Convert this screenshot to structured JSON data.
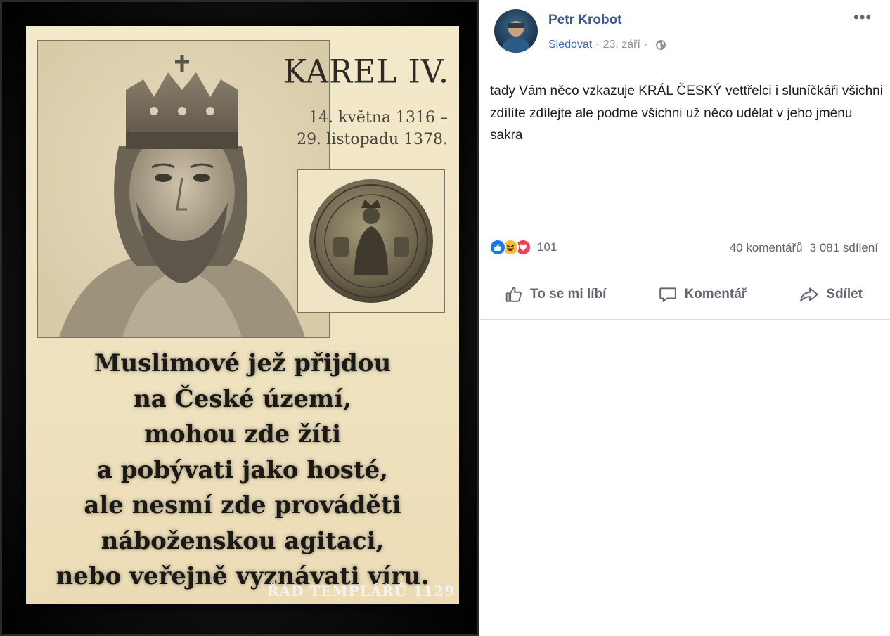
{
  "image": {
    "title": "KAREL IV.",
    "dates_line1": "14. května 1316 –",
    "dates_line2": "29. listopadu 1378.",
    "quote": "Muslimové jež přijdou\nna České území,\nmohou zde žíti\na pobývati jako hosté,\nale nesmí zde prováděti\nnáboženskou agitaci,\nnebo veřejně vyznávati víru.",
    "footer": "ŘÁD TEMPLÁŘŮ 1129"
  },
  "post": {
    "author": "Petr Krobot",
    "follow": "Sledovat",
    "separator": "·",
    "date": "23. září",
    "more": "•••",
    "text": "tady Vám něco vzkazuje KRÁL ČESKÝ vettřelci i sluníčkáři všichni zdílíte zdílejte ale podme všichni už něco udělat v jeho jménu sakra",
    "reaction_icons": [
      "like-icon",
      "haha-icon",
      "love-icon"
    ],
    "reaction_count": "101",
    "comments": "40 komentářů",
    "shares": "3 081 sdílení",
    "actions": {
      "like": "To se mi líbí",
      "comment": "Komentář",
      "share": "Sdílet"
    }
  },
  "colors": {
    "author_link": "#385898",
    "follow_link": "#4267b2",
    "muted": "#606770",
    "like_blue": "#1877f2",
    "love_red": "#f33e58",
    "haha_yellow": "#f7c033"
  }
}
